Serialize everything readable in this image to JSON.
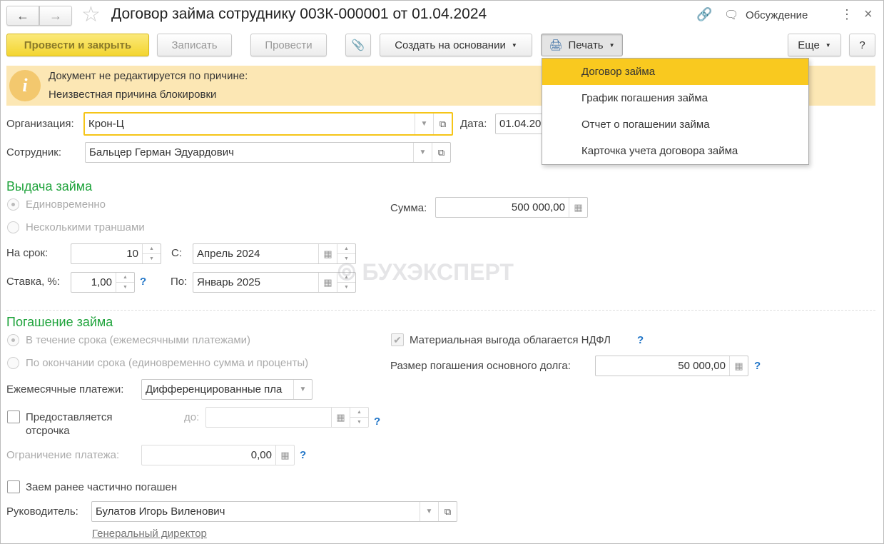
{
  "title": "Договор займа сотруднику 003К-000001 от 01.04.2024",
  "header": {
    "discussion": "Обсуждение"
  },
  "toolbar": {
    "post_close": "Провести и закрыть",
    "write": "Записать",
    "post": "Провести",
    "create_based": "Создать на основании",
    "print": "Печать",
    "more": "Еще",
    "help": "?"
  },
  "print_menu": [
    "Договор займа",
    "График погашения займа",
    "Отчет о погашении займа",
    "Карточка учета договора займа"
  ],
  "banner": {
    "line1": "Документ не редактируется по причине:",
    "line2": "Неизвестная причина блокировки"
  },
  "form": {
    "org_label": "Организация:",
    "org_value": "Крон-Ц",
    "date_label": "Дата:",
    "date_value": "01.04.20",
    "emp_label": "Сотрудник:",
    "emp_value": "Бальцер Герман Эдуардович",
    "issue_heading": "Выдача займа",
    "issue_once": "Единовременно",
    "issue_tranches": "Несколькими траншами",
    "sum_label": "Сумма:",
    "sum_value": "500 000,00",
    "term_label": "На срок:",
    "term_value": "10",
    "from_label": "С:",
    "from_value": "Апрель 2024",
    "rate_label": "Ставка, %:",
    "rate_value": "1,00",
    "to_label": "По:",
    "to_value": "Январь 2025",
    "watermark": "БУХЭКСПЕРТ",
    "repay_heading": "Погашение займа",
    "repay_monthly": "В течение срока (ежемесячными платежами)",
    "repay_end": "По окончании срока (единовременно сумма и проценты)",
    "benefit_label": "Материальная выгода облагается НДФЛ",
    "principal_label": "Размер погашения основного долга:",
    "principal_value": "50 000,00",
    "monthly_label": "Ежемесячные платежи:",
    "monthly_value": "Дифференцированные пла",
    "deferral_label": "Предоставляется отсрочка",
    "until_label": "до:",
    "limit_label": "Ограничение платежа:",
    "limit_value": "0,00",
    "partial_label": "Заем ранее частично погашен",
    "head_label": "Руководитель:",
    "head_value": "Булатов Игорь Виленович",
    "head_position": "Генеральный директор",
    "help": "?"
  }
}
